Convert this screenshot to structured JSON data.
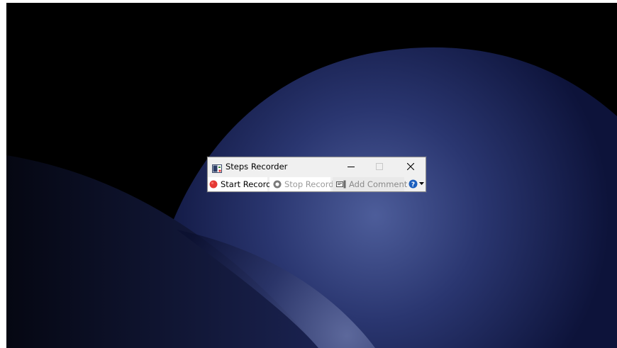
{
  "window": {
    "title": "Steps Recorder",
    "buttons": {
      "minimize": "–",
      "maximize": "□",
      "close": "✕"
    }
  },
  "toolbar": {
    "start_record_label": "Start Record",
    "stop_record_label": "Stop Record",
    "add_comment_label": "Add Comment",
    "help_icon": "help-icon",
    "dropdown_icon": "dropdown-arrow-icon"
  },
  "colors": {
    "record_red": "#e53935",
    "help_blue": "#1b5fbf",
    "disabled_text": "#9a9a9a"
  }
}
